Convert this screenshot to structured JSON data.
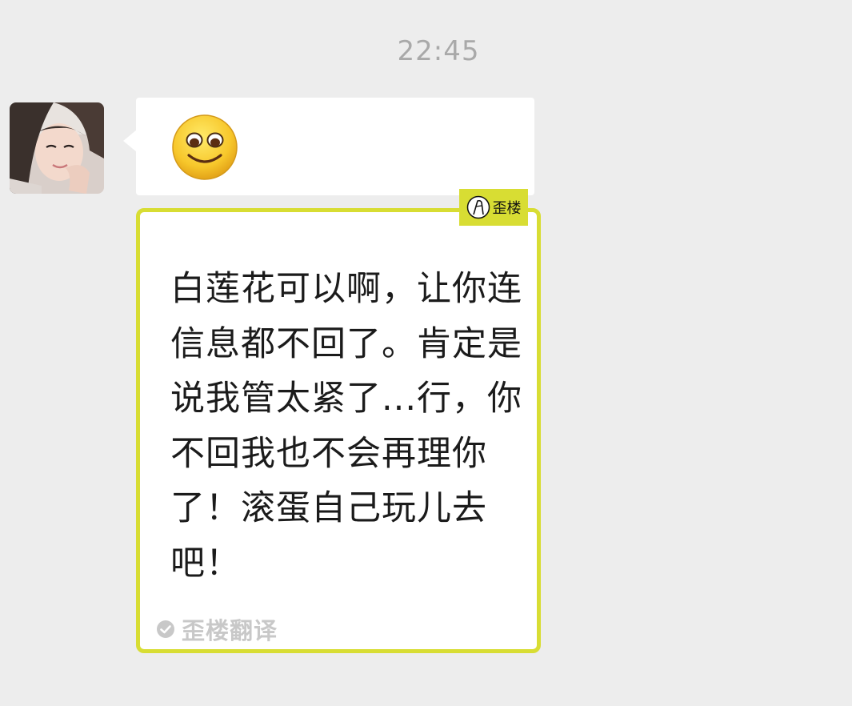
{
  "chat": {
    "timestamp": "22:45"
  },
  "message": {
    "emoji": "smiling-face-icon"
  },
  "translation": {
    "badge_label": "歪楼",
    "text": "白莲花可以啊，让你连信息都不回了。肯定是说我管太紧了...行，你不回我也不会再理你了！滚蛋自己玩儿去吧！",
    "footer_label": "歪楼翻译"
  },
  "colors": {
    "background": "#ededed",
    "accent": "#d8dd33",
    "bubble": "#ffffff",
    "timestamp": "#a9a9a9"
  }
}
